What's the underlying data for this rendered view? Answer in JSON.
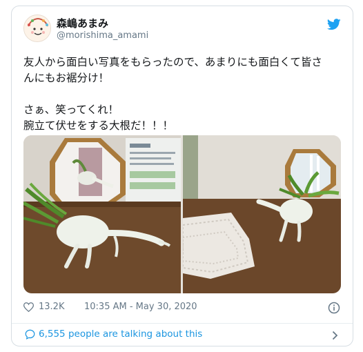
{
  "user": {
    "display_name": "森嶋あまみ",
    "handle": "@morishima_amami"
  },
  "tweet": {
    "lines": [
      "友人から面白い写真をもらったので、あまりにも面白くて皆さ",
      "んにもお裾分け！",
      "さぁ、笑ってくれ！",
      "腕立て伏せをする大根だ！！！"
    ]
  },
  "media": {
    "photos": [
      "daikon-mirror-photo",
      "daikon-doily-photo"
    ]
  },
  "meta": {
    "likes": "13.2K",
    "timestamp": "10:35 AM - May 30, 2020"
  },
  "footer": {
    "talking_text": "6,555 people are talking about this"
  },
  "colors": {
    "twitter_blue": "#1da1f2",
    "link_blue": "#1b95e0",
    "muted_gray": "#657786",
    "border": "#d6dde3"
  }
}
